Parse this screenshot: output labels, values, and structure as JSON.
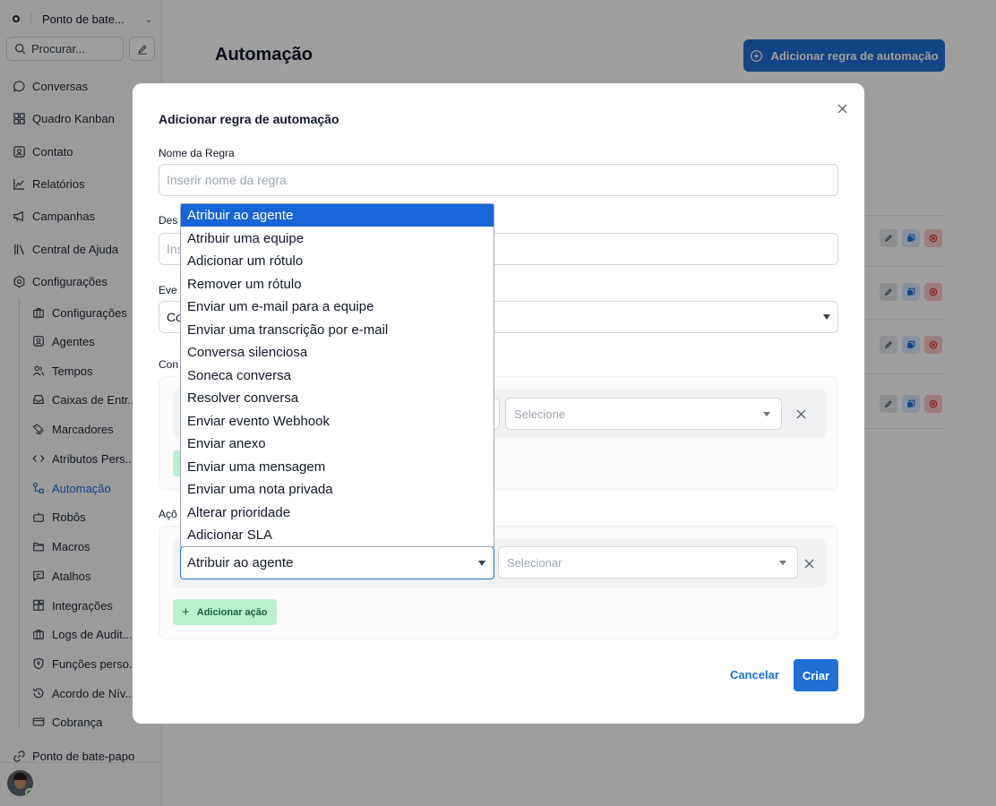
{
  "sidebar": {
    "account_name": "Ponto de bate...",
    "search_placeholder": "Procurar...",
    "nav": [
      {
        "label": "Conversas"
      },
      {
        "label": "Quadro Kanban"
      },
      {
        "label": "Contato"
      },
      {
        "label": "Relatórios"
      },
      {
        "label": "Campanhas"
      },
      {
        "label": "Central de Ajuda"
      },
      {
        "label": "Configurações"
      }
    ],
    "settings_items": [
      {
        "label": "Configurações"
      },
      {
        "label": "Agentes"
      },
      {
        "label": "Tempos"
      },
      {
        "label": "Caixas de Entr..."
      },
      {
        "label": "Marcadores"
      },
      {
        "label": "Atributos Pers..."
      },
      {
        "label": "Automação"
      },
      {
        "label": "Robôs"
      },
      {
        "label": "Macros"
      },
      {
        "label": "Atalhos"
      },
      {
        "label": "Integrações"
      },
      {
        "label": "Logs de Audit..."
      },
      {
        "label": "Funções perso..."
      },
      {
        "label": "Acordo de Nív..."
      },
      {
        "label": "Cobrança"
      }
    ],
    "bottom_item": "Ponto de bate-papo"
  },
  "main": {
    "title": "Automação",
    "add_button": "Adicionar regra de automação"
  },
  "modal": {
    "title": "Adicionar regra de automação",
    "rule_name_label": "Nome da Regra",
    "rule_name_placeholder": "Inserir nome da regra",
    "description_label": "Des",
    "description_placeholder": "Ins",
    "event_label": "Eve",
    "event_value": "Co",
    "conditions_label": "Con",
    "condition_value_placeholder": "Selecione",
    "actions_label": "Açõ",
    "action_selected": "Atribuir ao agente",
    "action_value_placeholder": "Selecionar",
    "add_action": "Adicionar ação",
    "cancel": "Cancelar",
    "create": "Criar"
  },
  "dropdown": {
    "options": [
      "Atribuir ao agente",
      "Atribuir uma equipe",
      "Adicionar um rótulo",
      "Remover um rótulo",
      "Enviar um e-mail para a equipe",
      "Enviar uma transcrição por e-mail",
      "Conversa silenciosa",
      "Soneca conversa",
      "Resolver conversa",
      "Enviar evento Webhook",
      "Enviar anexo",
      "Enviar uma mensagem",
      "Enviar uma nota privada",
      "Alterar prioridade",
      "Adicionar SLA"
    ],
    "highlighted": "Atribuir ao agente"
  },
  "colors": {
    "accent": "#1f6fd6",
    "highlight": "#1765d6",
    "add_green": "#bbf0cf"
  }
}
